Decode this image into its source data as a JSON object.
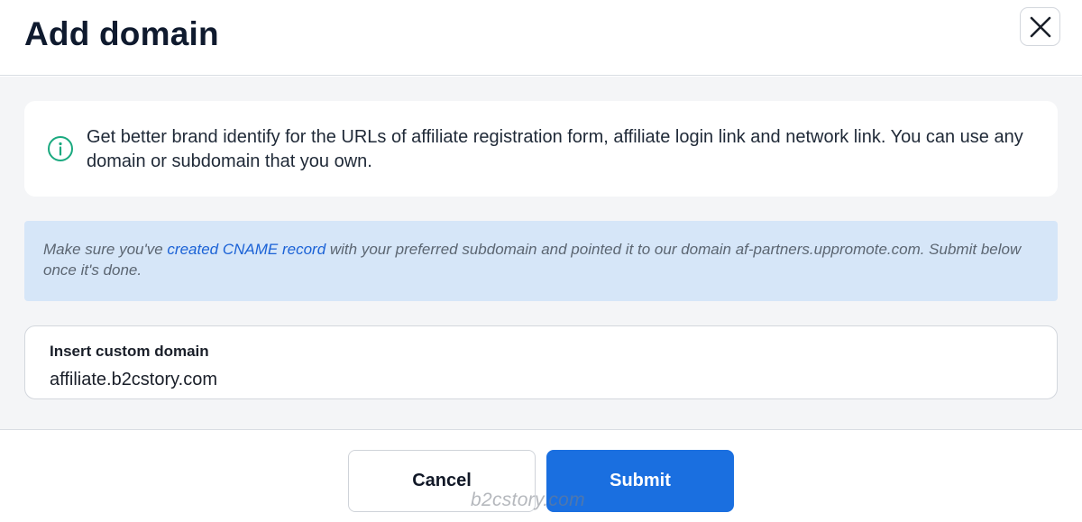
{
  "dialog": {
    "title": "Add domain",
    "close_icon": "close-icon"
  },
  "info": {
    "icon": "info-circle-icon",
    "text": "Get better brand identify for the URLs of affiliate registration form, affiliate login link and network link. You can use any domain or subdomain that you own.",
    "icon_color": "#1aa97f"
  },
  "notice": {
    "text_before": "Make sure you've ",
    "link": "created CNAME record",
    "text_after": " with your preferred subdomain and pointed it to our domain af-partners.uppromote.com. Submit below once it's done.",
    "link_color": "#1b62d6",
    "background": "#d6e6f8"
  },
  "custom_domain": {
    "label": "Insert custom domain",
    "value": "affiliate.b2cstory.com"
  },
  "footer": {
    "cancel_label": "Cancel",
    "submit_label": "Submit",
    "submit_color": "#1a6fe0"
  },
  "watermark": "b2cstory.com"
}
